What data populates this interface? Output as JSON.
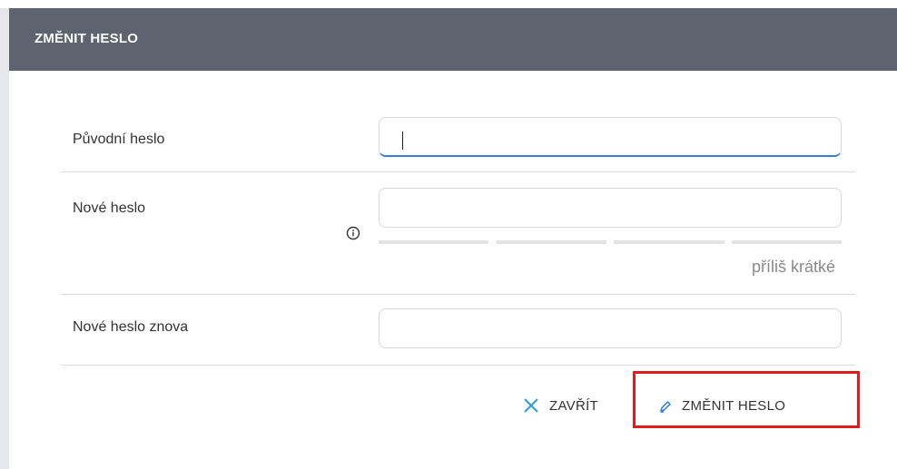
{
  "dialog": {
    "title": "ZMĚNIT HESLO"
  },
  "fields": {
    "original_password": {
      "label": "Původní heslo",
      "value": ""
    },
    "new_password": {
      "label": "Nové heslo",
      "value": "",
      "strength_text": "příliš krátké",
      "info_icon": "info-circle-icon"
    },
    "new_password_again": {
      "label": "Nové heslo znova",
      "value": ""
    }
  },
  "buttons": {
    "close_label": "ZAVŘÍT",
    "close_icon": "close-x-icon",
    "change_label": "ZMĚNIT HESLO",
    "change_icon": "pencil-icon"
  },
  "colors": {
    "header_bg": "#5d6470",
    "focus_underline": "#3a7bd5",
    "close_icon": "#2a9fd8",
    "change_icon": "#2a7fd8",
    "highlight_box": "#e01b1b"
  }
}
